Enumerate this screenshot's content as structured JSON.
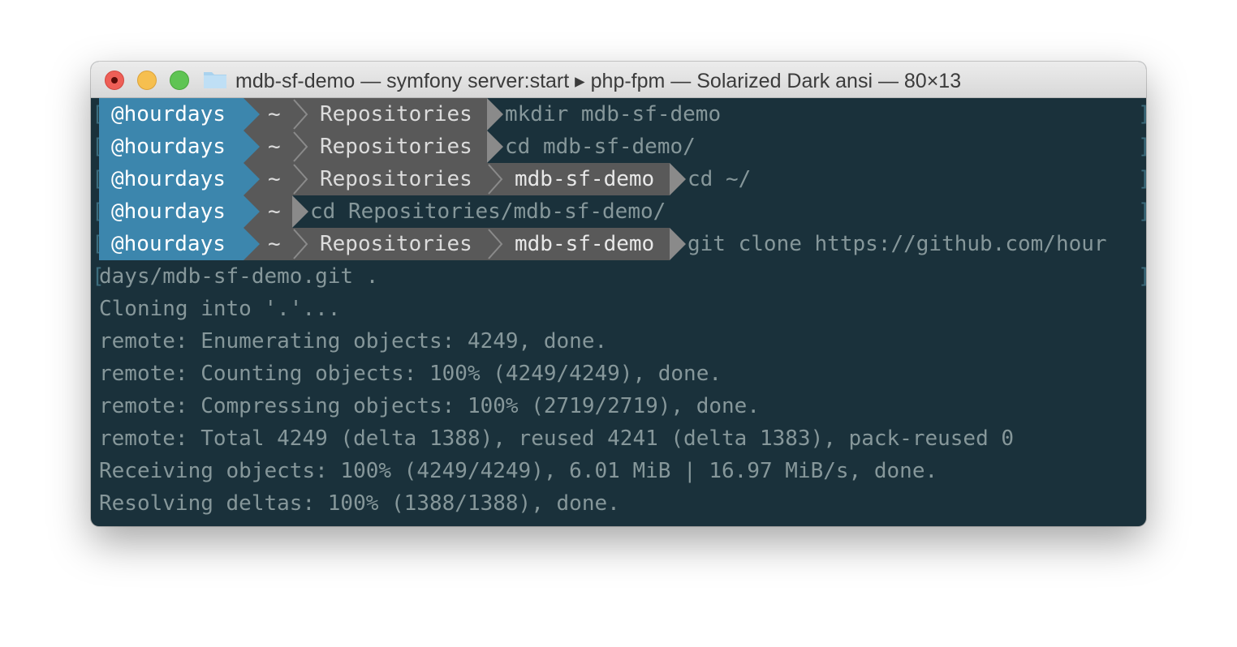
{
  "window": {
    "title": "mdb-sf-demo — symfony server:start ▸ php-fpm — Solarized Dark ansi — 80×13"
  },
  "colors": {
    "background": "#1a313b",
    "user_segment": "#3c86ad",
    "path_segment": "#595959",
    "text": "#86979a"
  },
  "prompt": {
    "user": "@hourdays",
    "home": "~",
    "dir1": "Repositories",
    "dir2": "mdb-sf-demo"
  },
  "commands": [
    "mkdir mdb-sf-demo",
    "cd mdb-sf-demo/",
    "cd ~/",
    "cd Repositories/mdb-sf-demo/",
    "git clone https://github.com/hour"
  ],
  "output": [
    "days/mdb-sf-demo.git .",
    "Cloning into '.'...",
    "remote: Enumerating objects: 4249, done.",
    "remote: Counting objects: 100% (4249/4249), done.",
    "remote: Compressing objects: 100% (2719/2719), done.",
    "remote: Total 4249 (delta 1388), reused 4241 (delta 1383), pack-reused 0",
    "Receiving objects: 100% (4249/4249), 6.01 MiB | 16.97 MiB/s, done.",
    "Resolving deltas: 100% (1388/1388), done."
  ],
  "brackets": {
    "open": "[",
    "close": "]"
  }
}
